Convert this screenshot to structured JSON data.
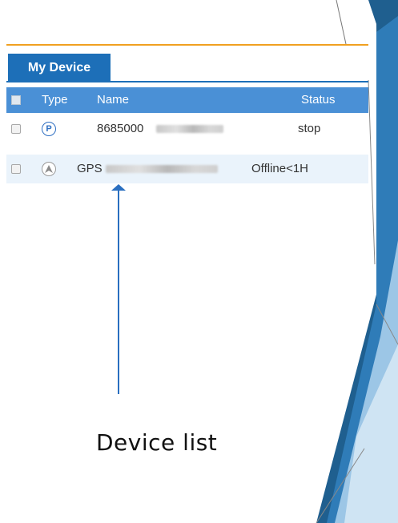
{
  "device_panel": {
    "tab_label": "My Device",
    "columns": {
      "type": "Type",
      "name": "Name",
      "status": "Status"
    },
    "rows": [
      {
        "type_icon": "parking-p-icon",
        "type_glyph": "P",
        "name": "8685000",
        "status": "stop"
      },
      {
        "type_icon": "offline-arrow-icon",
        "name": "GPS",
        "status": "Offline<1H"
      }
    ]
  },
  "annotation": {
    "caption": "Device list"
  },
  "colors": {
    "tab_blue": "#1d6fb8",
    "header_blue": "#4a90d6",
    "accent_orange": "#f0a020",
    "selected_row": "#eaf3fb",
    "arrow_blue": "#2a6fc0"
  }
}
